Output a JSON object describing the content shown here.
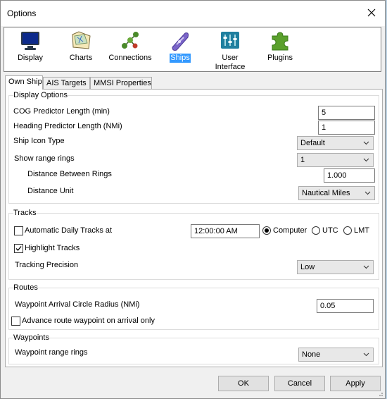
{
  "window": {
    "title": "Options"
  },
  "categories": [
    {
      "label": "Display",
      "icon": "monitor-icon"
    },
    {
      "label": "Charts",
      "icon": "charts-icon"
    },
    {
      "label": "Connections",
      "icon": "connections-icon"
    },
    {
      "label": "Ships",
      "icon": "ship-icon",
      "selected": true
    },
    {
      "label": "User\nInterface",
      "icon": "sliders-icon"
    },
    {
      "label": "Plugins",
      "icon": "puzzle-icon"
    }
  ],
  "tabs": [
    "Own Ship",
    "AIS Targets",
    "MMSI Properties"
  ],
  "display_options": {
    "title": "Display Options",
    "cog_label": "COG Predictor Length (min)",
    "cog_value": "5",
    "heading_label": "Heading Predictor Length (NMi)",
    "heading_value": "1",
    "ship_icon_label": "Ship Icon Type",
    "ship_icon_value": "Default",
    "range_rings_label": "Show range rings",
    "range_rings_value": "1",
    "ring_distance_label": "Distance Between Rings",
    "ring_distance_value": "1.000",
    "unit_label": "Distance Unit",
    "unit_value": "Nautical Miles"
  },
  "tracks": {
    "title": "Tracks",
    "auto_daily_label": "Automatic Daily Tracks at",
    "auto_daily_checked": false,
    "time_value": "12:00:00 AM",
    "tz_options": [
      "Computer",
      "UTC",
      "LMT"
    ],
    "tz_selected": "Computer",
    "highlight_label": "Highlight Tracks",
    "highlight_checked": true,
    "precision_label": "Tracking Precision",
    "precision_value": "Low"
  },
  "routes": {
    "title": "Routes",
    "radius_label": "Waypoint Arrival Circle Radius (NMi)",
    "radius_value": "0.05",
    "advance_label": "Advance route waypoint on arrival only",
    "advance_checked": false
  },
  "waypoints": {
    "title": "Waypoints",
    "rings_label": "Waypoint range rings",
    "rings_value": "None"
  },
  "buttons": {
    "ok": "OK",
    "cancel": "Cancel",
    "apply": "Apply"
  }
}
